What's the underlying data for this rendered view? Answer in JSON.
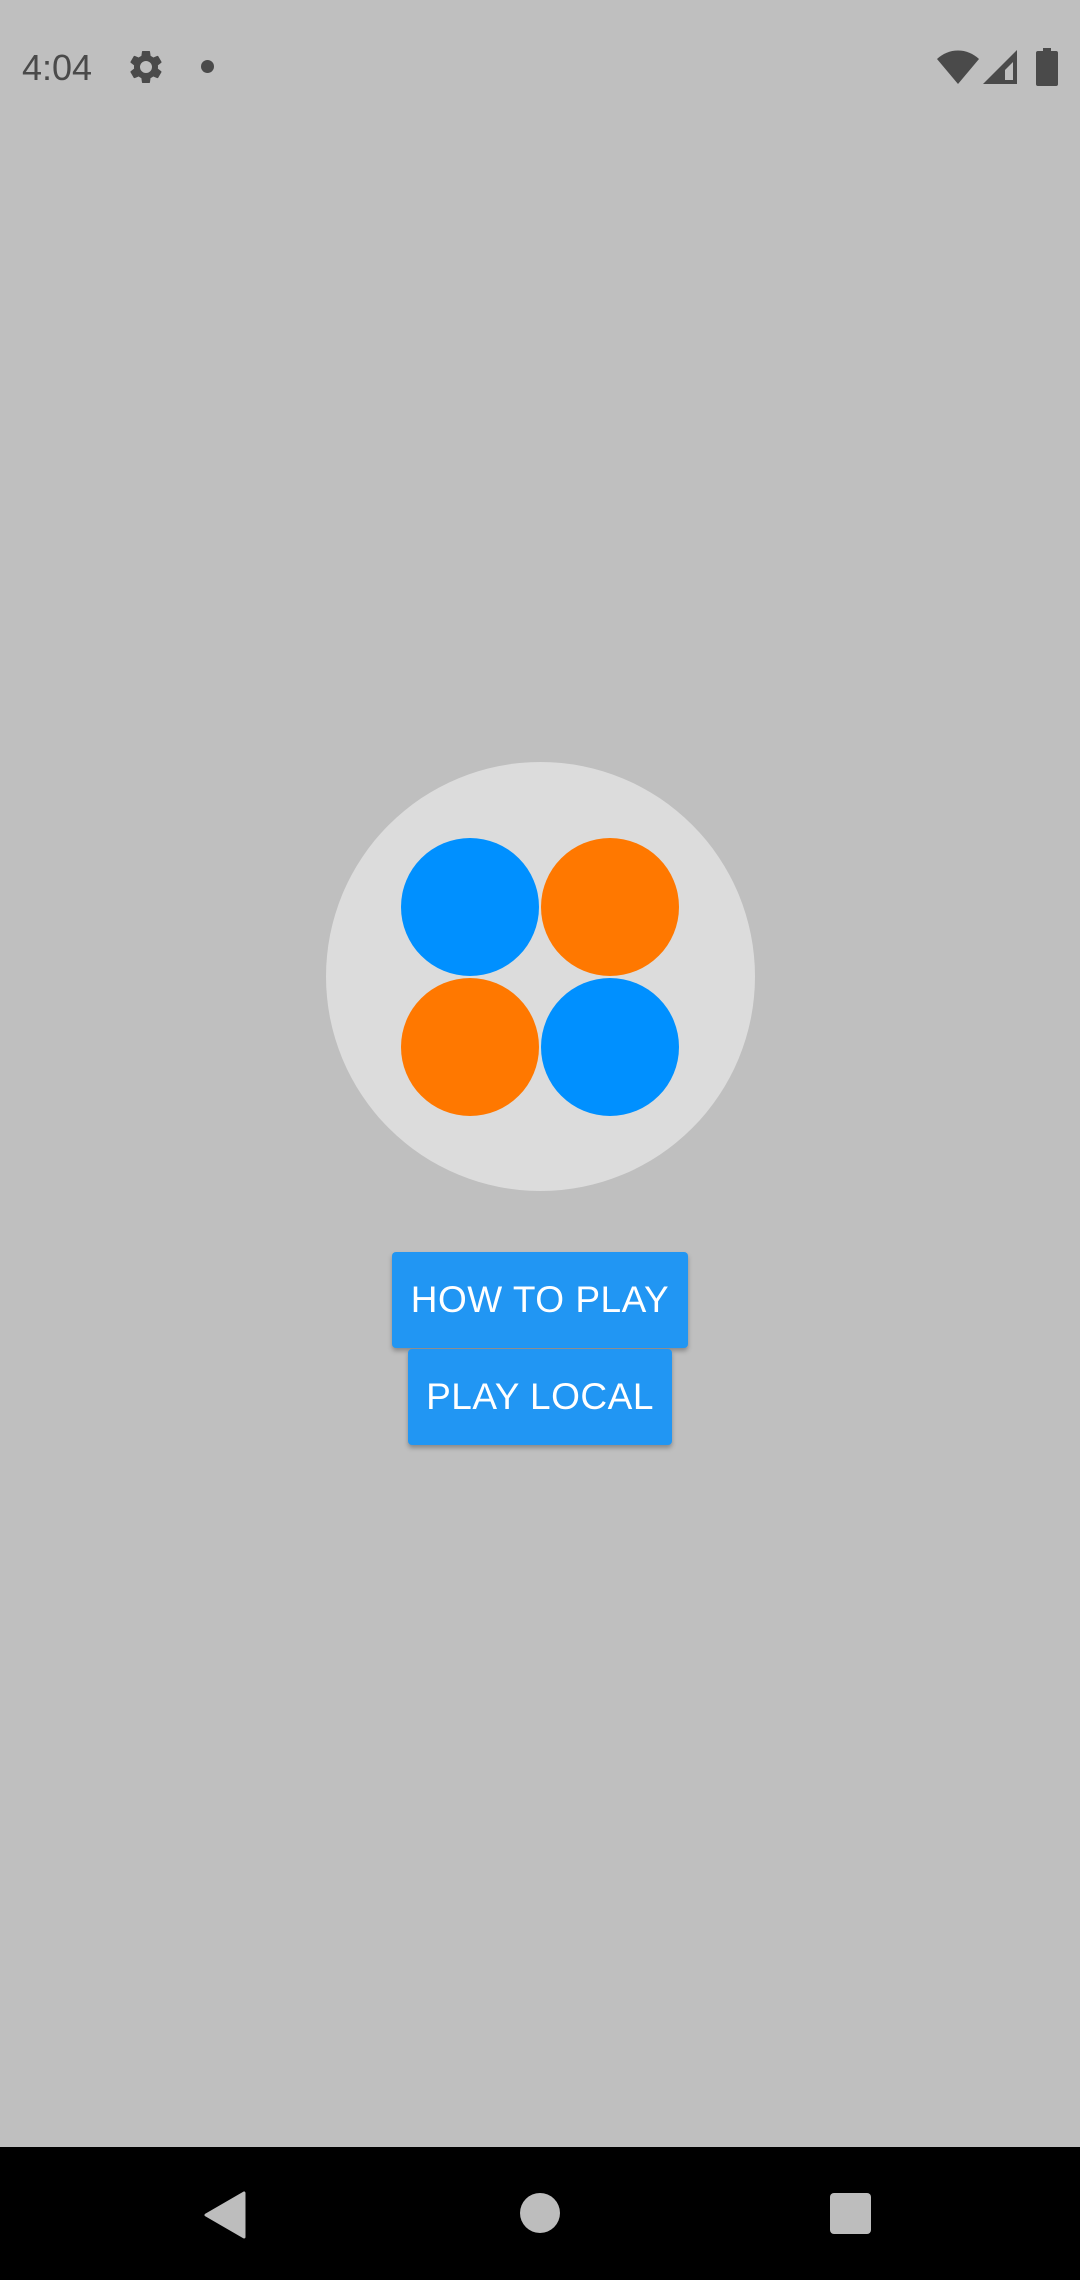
{
  "status_bar": {
    "time": "4:04",
    "icons": [
      "gear-icon",
      "notification-dot-icon",
      "wifi-icon",
      "cell-signal-icon",
      "battery-icon"
    ],
    "icon_color": "#4a4a4a"
  },
  "logo": {
    "background_color": "#dcdcdc",
    "dots": [
      {
        "position": "top-left",
        "color": "#0090ff"
      },
      {
        "position": "top-right",
        "color": "#ff7800"
      },
      {
        "position": "bottom-left",
        "color": "#ff7800"
      },
      {
        "position": "bottom-right",
        "color": "#0090ff"
      }
    ]
  },
  "menu": {
    "how_to_play_label": "HOW TO PLAY",
    "play_local_label": "PLAY LOCAL",
    "button_color": "#2196f3"
  },
  "nav_bar": {
    "icons": [
      "back-icon",
      "home-icon",
      "recents-icon"
    ]
  },
  "colors": {
    "background": "#bfbfbf",
    "nav_background": "#000000",
    "nav_icon": "#bdbdbd"
  }
}
